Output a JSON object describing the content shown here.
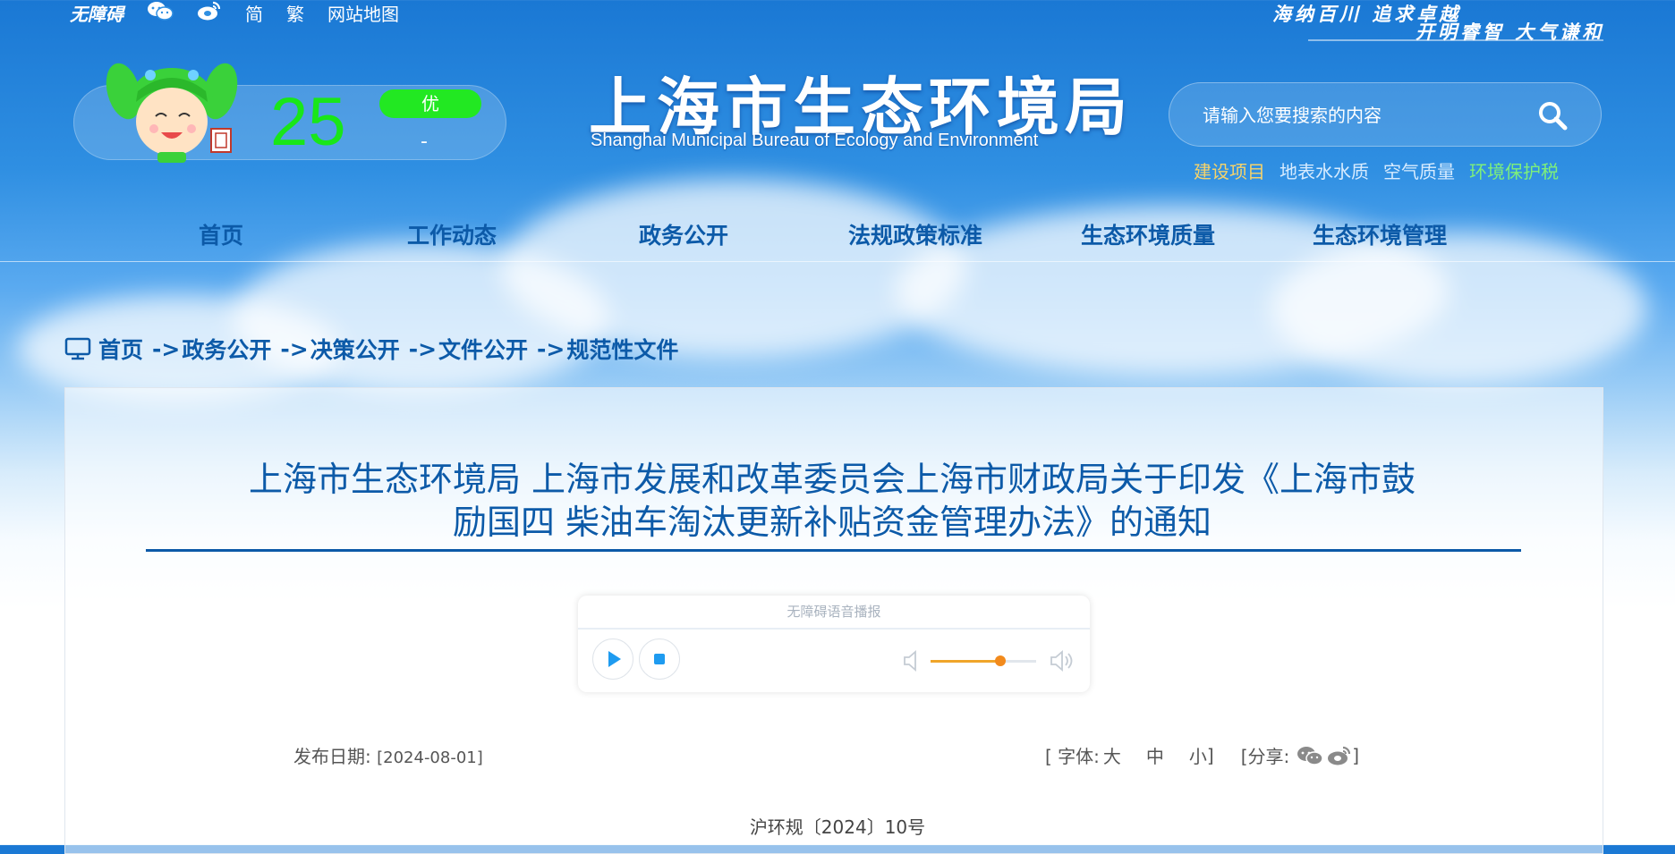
{
  "topbar": {
    "accessibility": "无障碍",
    "simplified": "简",
    "traditional": "繁",
    "sitemap": "网站地图",
    "slogan_line1": "海纳百川 追求卓越",
    "slogan_line2": "开明睿智 大气谦和"
  },
  "aqi": {
    "value": "25",
    "level": "优",
    "pollutant": "-"
  },
  "logo": {
    "title": "上海市生态环境局",
    "subtitle": "Shanghai Municipal Bureau of Ecology and Environment"
  },
  "search": {
    "placeholder": "请输入您要搜索的内容"
  },
  "quick_links": [
    {
      "label": "建设项目",
      "color": "#f5d36b"
    },
    {
      "label": "地表水水质",
      "color": "#d8ecff"
    },
    {
      "label": "空气质量",
      "color": "#d8ecff"
    },
    {
      "label": "环境保护税",
      "color": "#7ef07a"
    }
  ],
  "nav": [
    "首页",
    "工作动态",
    "政务公开",
    "法规政策标准",
    "生态环境质量",
    "生态环境管理"
  ],
  "breadcrumb": {
    "items": [
      "首页",
      "政务公开",
      "决策公开",
      "文件公开",
      "规范性文件"
    ],
    "separator": "->"
  },
  "article": {
    "title_line1": "上海市生态环境局 上海市发展和改革委员会上海市财政局关于印发《上海市鼓",
    "title_line2": "励国四 柴油车淘汰更新补贴资金管理办法》的通知",
    "publish_label": "发布日期:",
    "publish_date": "[2024-08-01]",
    "font_open": "[ 字体:",
    "font_large": "大",
    "font_medium": "中",
    "font_small": "小",
    "font_close": "]",
    "share_open": "[分享:",
    "share_close": "]",
    "doc_number": "沪环规〔2024〕10号"
  },
  "player": {
    "title": "无障碍语音播报",
    "volume": 0.66
  },
  "colors": {
    "primary": "#0c5aa8",
    "aqi_green": "#22e822"
  }
}
